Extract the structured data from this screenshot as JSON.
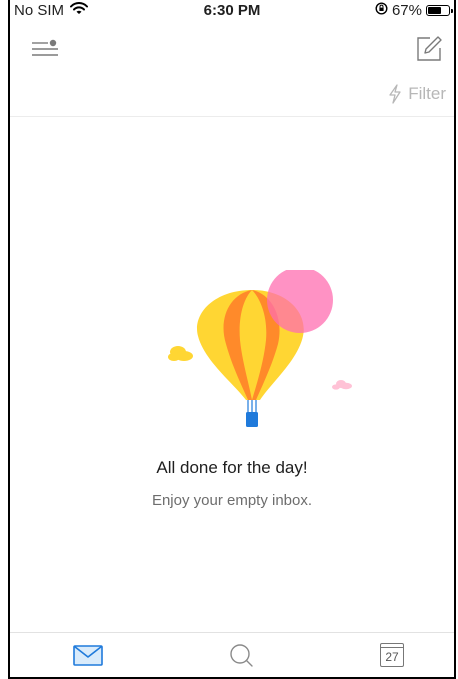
{
  "status_bar": {
    "carrier": "No SIM",
    "time": "6:30 PM",
    "battery_percent": "67%",
    "battery_level": 0.67
  },
  "header": {
    "menu_icon": "menu-icon",
    "compose_icon": "compose-icon",
    "filter_label": "Filter",
    "filter_icon": "lightning-icon"
  },
  "empty_state": {
    "title": "All done for the day!",
    "subtitle": "Enjoy your empty inbox.",
    "illustration": "hot-air-balloon"
  },
  "tabs": [
    {
      "name": "mail",
      "icon": "mail-icon",
      "active": true
    },
    {
      "name": "search",
      "icon": "search-icon",
      "active": false
    },
    {
      "name": "calendar",
      "icon": "calendar-icon",
      "label": "27",
      "active": false
    }
  ],
  "colors": {
    "accent": "#1f7adb",
    "balloon_yellow": "#ffd633",
    "balloon_orange": "#ff7a2f",
    "sun_pink": "#ff6eb0",
    "muted": "#b7b7b7"
  }
}
